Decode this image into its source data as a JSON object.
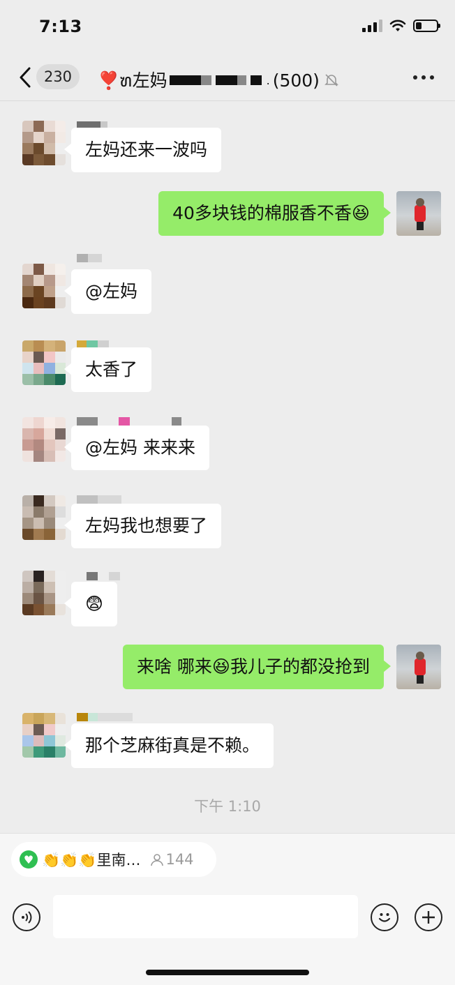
{
  "status_bar": {
    "time": "7:13"
  },
  "header": {
    "unread_count": "230",
    "title_prefix": "❣️ຑ左妈",
    "member_count": "(500)",
    "mute_icon": "bell-slash-icon",
    "more_icon": "ellipsis-icon"
  },
  "messages": [
    {
      "side": "left",
      "text": "左妈还来一波吗"
    },
    {
      "side": "right",
      "text": "40多块钱的棉服香不香😆"
    },
    {
      "side": "left",
      "text": "@左妈"
    },
    {
      "side": "left",
      "text": "太香了"
    },
    {
      "side": "left",
      "text": "@左妈 来来来"
    },
    {
      "side": "left",
      "text": "左妈我也想要了"
    },
    {
      "side": "left",
      "text": "😨"
    },
    {
      "side": "right",
      "text": "来啥  哪来😆我儿子的都没抢到"
    },
    {
      "side": "left",
      "text": "那个芝麻街真是不赖。"
    }
  ],
  "timestamp": "下午 1:10",
  "bottom_bar": {
    "pill_text": "👏👏👏里南…",
    "pill_count": "144",
    "voice_icon": "voice-icon",
    "emoji_icon": "emoji-icon",
    "add_icon": "plus-icon",
    "input_value": ""
  }
}
